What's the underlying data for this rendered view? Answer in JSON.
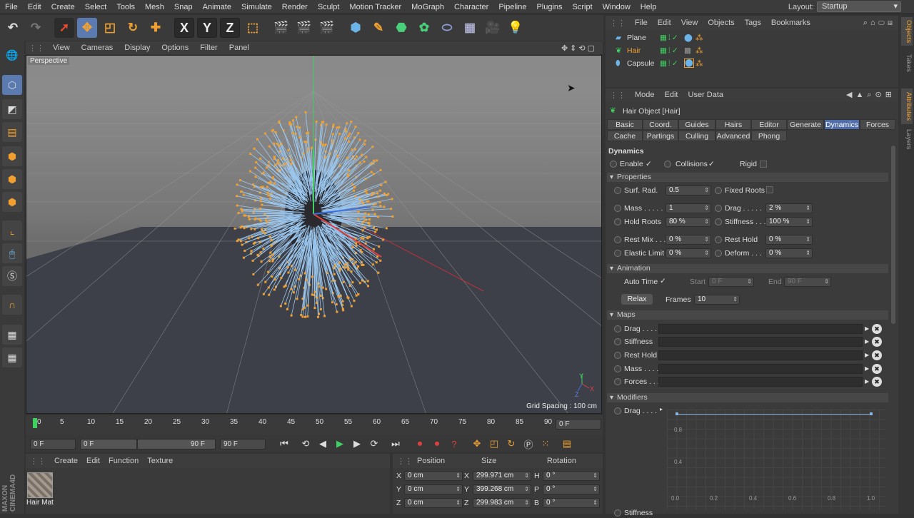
{
  "menubar": {
    "items": [
      "File",
      "Edit",
      "Create",
      "Select",
      "Tools",
      "Mesh",
      "Snap",
      "Animate",
      "Simulate",
      "Render",
      "Sculpt",
      "Motion Tracker",
      "MoGraph",
      "Character",
      "Pipeline",
      "Plugins",
      "Script",
      "Window",
      "Help"
    ],
    "layout_label": "Layout:",
    "layout_value": "Startup"
  },
  "toolbar": {
    "x_label": "X",
    "y_label": "Y",
    "z_label": "Z"
  },
  "viewport": {
    "menu": [
      "View",
      "Cameras",
      "Display",
      "Options",
      "Filter",
      "Panel"
    ],
    "camera_label": "Perspective",
    "grid_spacing": "Grid Spacing : 100 cm",
    "axis_y": "Y",
    "axis_x": "X",
    "axis_z": "Z"
  },
  "timeline": {
    "ticks": [
      "0",
      "5",
      "10",
      "15",
      "20",
      "25",
      "30",
      "35",
      "40",
      "45",
      "50",
      "55",
      "60",
      "65",
      "70",
      "75",
      "80",
      "85",
      "90"
    ],
    "current_frame": "0 F",
    "start_frame": "0 F",
    "range_start": "0 F",
    "range_end": "90 F",
    "end_frame": "90 F"
  },
  "material_manager": {
    "menu": [
      "Create",
      "Edit",
      "Function",
      "Texture"
    ],
    "material_name": "Hair Mat"
  },
  "coordinates": {
    "headers": [
      "Position",
      "Size",
      "Rotation"
    ],
    "rows": [
      {
        "axis": "X",
        "pos": "0 cm",
        "size_axis": "X",
        "size": "299.971 cm",
        "rot_axis": "H",
        "rot": "0 °"
      },
      {
        "axis": "Y",
        "pos": "0 cm",
        "size_axis": "Y",
        "size": "399.268 cm",
        "rot_axis": "P",
        "rot": "0 °"
      },
      {
        "axis": "Z",
        "pos": "0 cm",
        "size_axis": "Z",
        "size": "299.983 cm",
        "rot_axis": "B",
        "rot": "0 °"
      }
    ]
  },
  "object_manager": {
    "menu": [
      "File",
      "Edit",
      "View",
      "Objects",
      "Tags",
      "Bookmarks"
    ],
    "objects": [
      {
        "name": "Plane",
        "selected": false
      },
      {
        "name": "Hair",
        "selected": true
      },
      {
        "name": "Capsule",
        "selected": false
      }
    ]
  },
  "attributes": {
    "menu": [
      "Mode",
      "Edit",
      "User Data"
    ],
    "object_title": "Hair Object [Hair]",
    "tabs_row1": [
      "Basic",
      "Coord.",
      "Guides",
      "Hairs",
      "Editor",
      "Generate",
      "Dynamics",
      "Forces"
    ],
    "tabs_row2": [
      "Cache",
      "Partings",
      "Culling",
      "Advanced",
      "Phong"
    ],
    "active_tab": "Dynamics",
    "section_title": "Dynamics",
    "enable_label": "Enable",
    "collisions_label": "Collisions",
    "rigid_label": "Rigid",
    "properties_title": "Properties",
    "surf_rad_label": "Surf. Rad.",
    "surf_rad": "0.5",
    "fixed_roots_label": "Fixed Roots",
    "mass_label": "Mass . . . . .",
    "mass": "1",
    "drag_label": "Drag . . . . .",
    "drag": "2 %",
    "hold_roots_label": "Hold Roots",
    "hold_roots": "80 %",
    "stiffness_label": "Stiffness . . .",
    "stiffness": "100 %",
    "rest_mix_label": "Rest Mix . . .",
    "rest_mix": "0 %",
    "rest_hold_label": "Rest Hold",
    "rest_hold": "0 %",
    "elastic_limit_label": "Elastic Limit",
    "elastic_limit": "0 %",
    "deform_label": "Deform . . .",
    "deform": "0 %",
    "animation_title": "Animation",
    "auto_time_label": "Auto Time",
    "start_label": "Start",
    "start": "0 F",
    "end_label": "End",
    "end": "90 F",
    "relax_label": "Relax",
    "frames_label": "Frames",
    "frames": "10",
    "maps_title": "Maps",
    "maps": [
      "Drag . . . .",
      "Stiffness",
      "Rest Hold",
      "Mass . . . .",
      "Forces . . . ."
    ],
    "modifiers_title": "Modifiers",
    "modifier_drag_label": "Drag . . . .",
    "graph_y_labels": [
      "0.8",
      "0.4"
    ],
    "graph_x_labels": [
      "0.0",
      "0.2",
      "0.4",
      "0.6",
      "0.8",
      "1.0"
    ],
    "modifier_stiffness_label": "Stiffness"
  },
  "side_tabs": [
    "Objects",
    "Takes",
    "Attributes",
    "Layers"
  ],
  "brand": "MAXON CINEMA4D",
  "colors": {
    "accent": "#4f6dab",
    "hair_strand": "#9cc8f0",
    "hair_tip": "#f0a030",
    "viewport_floor": "#3d4048"
  }
}
